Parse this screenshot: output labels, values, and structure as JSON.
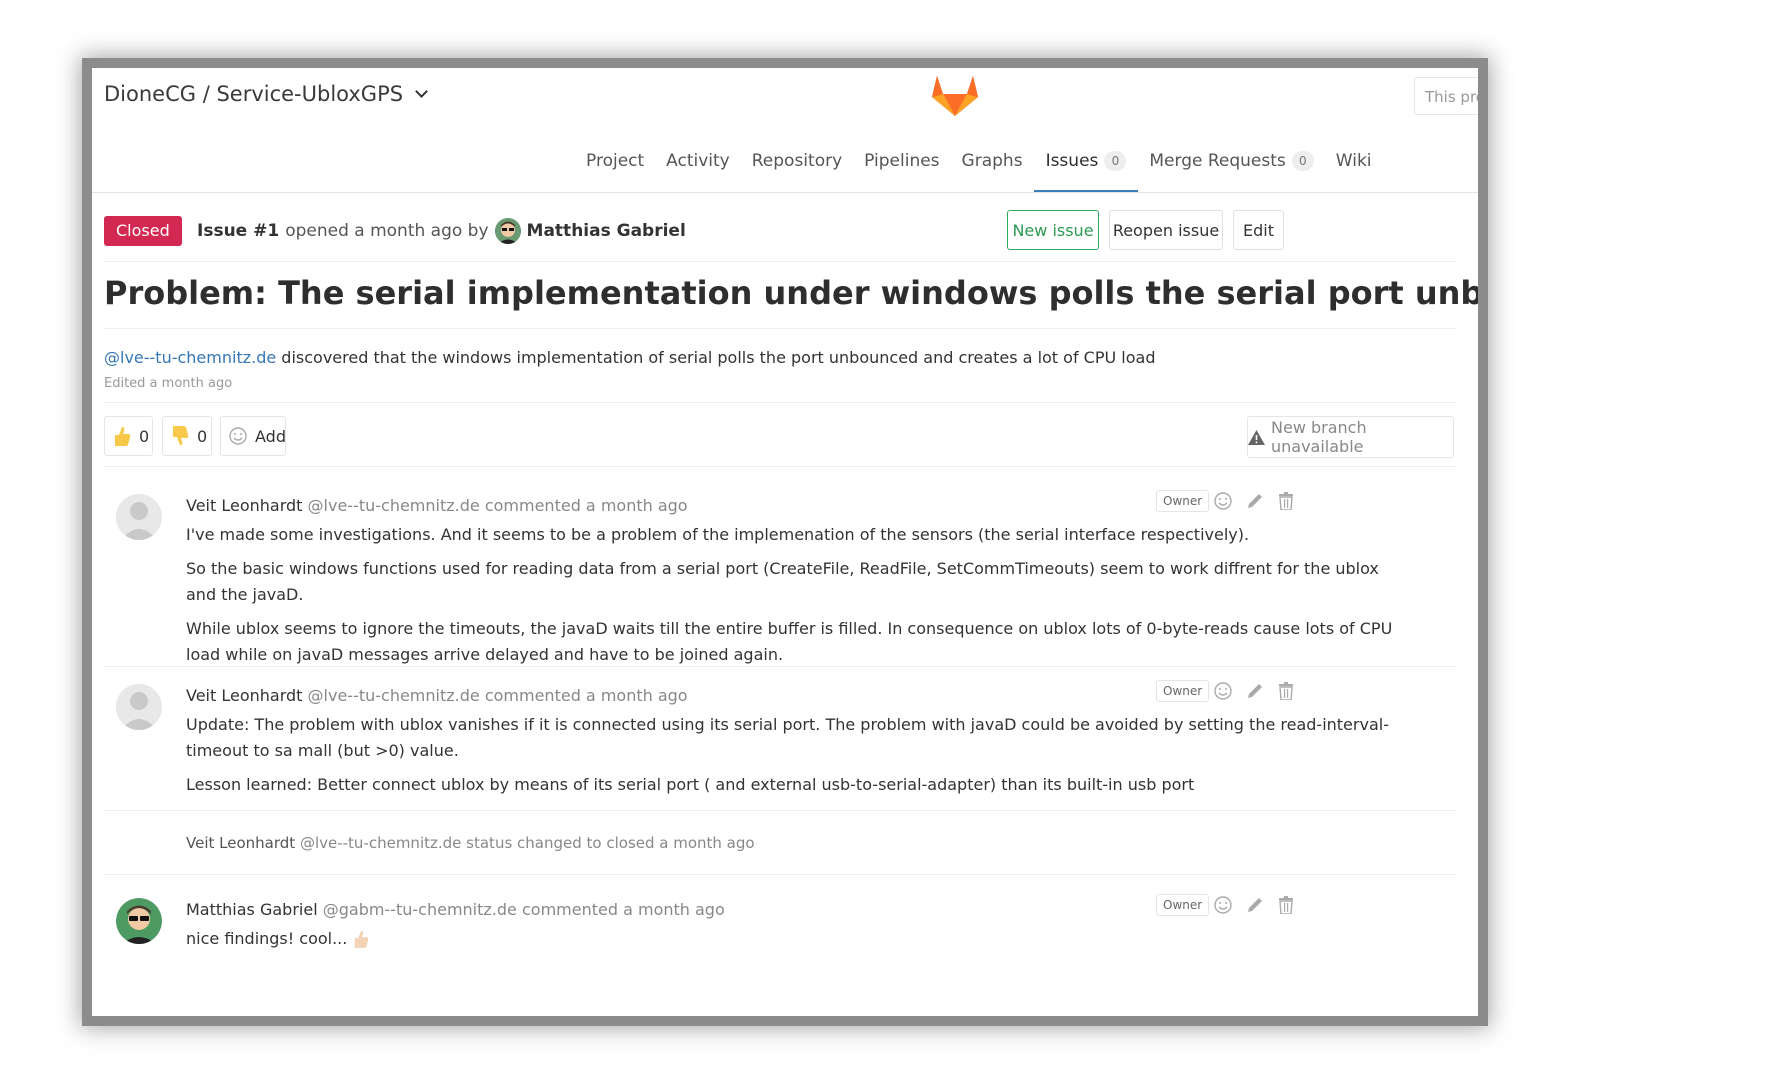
{
  "project": {
    "breadcrumb": "DioneCG / Service-UbloxGPS"
  },
  "search": {
    "placeholder": "This pro"
  },
  "nav": [
    {
      "label": "Project"
    },
    {
      "label": "Activity"
    },
    {
      "label": "Repository"
    },
    {
      "label": "Pipelines"
    },
    {
      "label": "Graphs"
    },
    {
      "label": "Issues",
      "count": "0",
      "active": true
    },
    {
      "label": "Merge Requests",
      "count": "0"
    },
    {
      "label": "Wiki"
    }
  ],
  "issue": {
    "status": "Closed",
    "ref": "Issue #1",
    "opened": "opened a month ago by",
    "author": "Matthias Gabriel",
    "title": "Problem: The serial implementation under windows polls the serial port unbounced",
    "mention": "@lve--tu-chemnitz.de",
    "description": "discovered that the windows implementation of serial polls the port unbounced and creates a lot of CPU load",
    "edited": "Edited a month ago"
  },
  "buttons": {
    "new_issue": "New issue",
    "reopen": "Reopen issue",
    "edit": "Edit"
  },
  "awards": {
    "thumbsup": "0",
    "thumbsdown": "0",
    "add": "Add"
  },
  "new_branch": "New branch unavailable",
  "notes": [
    {
      "author": "Veit Leonhardt",
      "handle": "@lve--tu-chemnitz.de",
      "action": "commented a month ago",
      "role": "Owner",
      "paragraphs": [
        "I've made some investigations. And it seems to be a problem of the implemenation of the sensors (the serial interface respectively).",
        "So the basic windows functions used for reading data from a serial port (CreateFile, ReadFile, SetCommTimeouts) seem to work diffrent for the ublox and the javaD.",
        "While ublox seems to ignore the timeouts, the javaD waits till the entire buffer is filled. In consequence on ublox lots of 0-byte-reads cause lots of CPU load while on javaD messages arrive delayed and have to be joined again."
      ]
    },
    {
      "author": "Veit Leonhardt",
      "handle": "@lve--tu-chemnitz.de",
      "action": "commented a month ago",
      "role": "Owner",
      "paragraphs": [
        "Update: The problem with ublox vanishes if it is connected using its serial port. The problem with javaD could be avoided by setting the read-interval-timeout to sa mall (but >0) value.",
        "Lesson learned: Better connect ublox by means of its serial port ( and external usb-to-serial-adapter) than its built-in usb port"
      ]
    },
    {
      "author": "Matthias Gabriel",
      "handle": "@gabm--tu-chemnitz.de",
      "action": "commented a month ago",
      "role": "Owner",
      "paragraphs": [
        "nice findings! cool..."
      ]
    }
  ],
  "system_note": {
    "author": "Veit Leonhardt",
    "handle": "@lve--tu-chemnitz.de",
    "action": "status changed to closed a month ago"
  },
  "colors": {
    "closed": "#d22852",
    "link": "#3577b5",
    "active_tab": "#3a80bb",
    "new_issue": "#2eaa5e"
  }
}
